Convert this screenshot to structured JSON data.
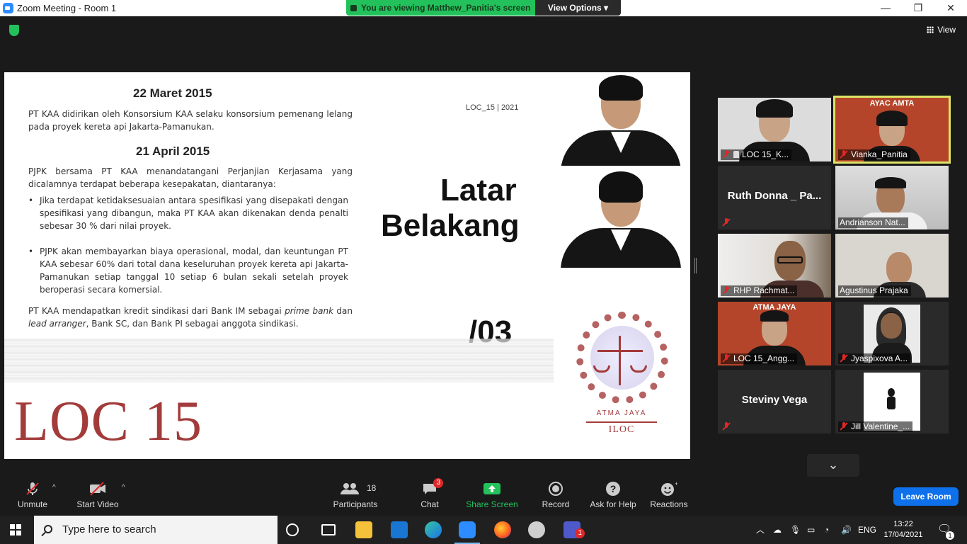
{
  "window": {
    "title": "Zoom Meeting - Room 1",
    "minimize": "—",
    "maximize": "❐",
    "close": "✕"
  },
  "banner": {
    "message": "You are viewing Matthew_Panitia's screen",
    "view_options": "View Options ▾"
  },
  "topbar": {
    "view_label": "View"
  },
  "slide": {
    "heading1": "22 Maret 2015",
    "para1": "PT KAA didirikan oleh Konsorsium KAA selaku konsorsium pemenang lelang pada proyek kereta api Jakarta-Pamanukan.",
    "heading2": "21 April 2015",
    "para2": "PJPK bersama PT KAA menandatangani Perjanjian Kerjasama yang dicalamnya terdapat beberapa kesepakatan, diantaranya:",
    "bullet1": "Jika terdapat ketidaksesuaian antara spesifikasi yang disepakati dengan spesifikasi yang dibangun, maka PT KAA akan dikenakan denda penalti sebesar 30 % dari nilai proyek.",
    "bullet2": "PJPK akan membayarkan biaya operasional, modal, dan keuntungan PT KAA sebesar 60% dari total dana keseluruhan proyek kereta api Jakarta-Pamanukan setiap tanggal 10 setiap 6 bulan sekali setelah proyek beroperasi secara komersial.",
    "para3_prefix": "PT KAA mendapatkan kredit sindikasi dari Bank IM sebagai ",
    "para3_em1": "prime bank",
    "para3_mid": " dan ",
    "para3_em2": "lead arranger",
    "para3_suffix": ", Bank SC, dan Bank PI sebagai anggota sindikasi.",
    "meta": "LOC_15 | 2021",
    "title_line1": "Latar",
    "title_line2": "Belakang",
    "number": "/03",
    "footer_logo": "LOC 15",
    "emblem_line1": "ATMA JAYA",
    "emblem_line2": "ILOC"
  },
  "participants": [
    {
      "name": "LOC 15_K...",
      "muted": true,
      "pinned": true,
      "video": true,
      "bg": "#d9d9d9"
    },
    {
      "name": "Vianka_Panitia",
      "muted": true,
      "video": true,
      "active_speaker": true,
      "bg": "#b5452a",
      "banner": "AYAC AMTA"
    },
    {
      "name": "Ruth  Donna _ Pa...",
      "muted": true,
      "video": false
    },
    {
      "name": "Andrianson Nat...",
      "muted": false,
      "video": true,
      "bg": "#c9c9c9"
    },
    {
      "name": "RHP Rachmat...",
      "muted": true,
      "video": true,
      "bg": "#8a7a6a"
    },
    {
      "name": "Agustinus Prajaka",
      "muted": false,
      "video": true,
      "bg": "#d6d2cc"
    },
    {
      "name": "LOC 15_Angg...",
      "muted": true,
      "video": true,
      "bg": "#b5452a",
      "banner": "ATMA JAYA"
    },
    {
      "name": "Jyaspixova A...",
      "muted": true,
      "video": true,
      "bg": "#e9e9e9"
    },
    {
      "name": "Steviny Vega",
      "muted": true,
      "video": false
    },
    {
      "name": "Jill Valentine_...",
      "muted": true,
      "video": true,
      "bg": "#ffffff"
    }
  ],
  "toolbar": {
    "unmute": "Unmute",
    "start_video": "Start Video",
    "participants": "Participants",
    "participants_count": "18",
    "chat": "Chat",
    "chat_badge": "3",
    "share_screen": "Share Screen",
    "record": "Record",
    "ask_for_help": "Ask for Help",
    "reactions": "Reactions",
    "leave_room": "Leave Room"
  },
  "taskbar": {
    "search_placeholder": "Type here to search",
    "language": "ENG",
    "time": "13:22",
    "date": "17/04/2021",
    "notification_count": "1",
    "teams_badge": "1"
  },
  "colors": {
    "accent_green": "#23c15b",
    "zoom_blue": "#0e71eb",
    "loc_red": "#a33b3b",
    "active_speaker": "#dde365"
  }
}
